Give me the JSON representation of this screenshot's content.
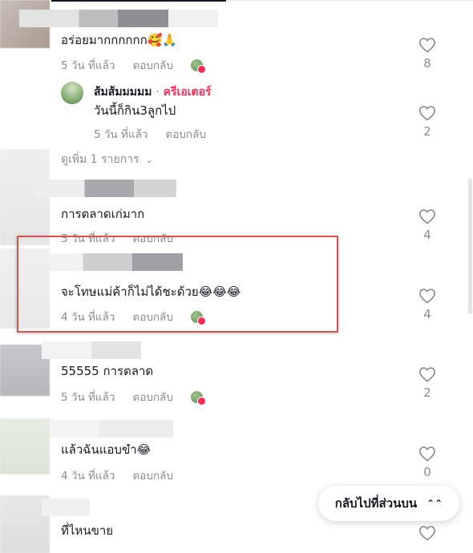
{
  "comments": [
    {
      "text": "อร่อยมากกกกกก🥰🙏",
      "time": "5 วัน ที่แล้ว",
      "reply": "ตอบกลับ",
      "likes": "8",
      "creator_liked": true
    },
    {
      "text": "การตลาดเก่มาก",
      "time": "3 วัน ที่แล้ว",
      "reply": "ตอบกลับ",
      "likes": "4",
      "creator_liked": false
    },
    {
      "text": "จะโทษแม่ค้าก็ไม่ได้ชะด้วย😂😂😂",
      "time": "4 วัน ที่แล้ว",
      "reply": "ตอบกลับ",
      "likes": "4",
      "creator_liked": true
    },
    {
      "text": "55555 การตลาด",
      "time": "5 วัน ที่แล้ว",
      "reply": "ตอบกลับ",
      "likes": "2",
      "creator_liked": true
    },
    {
      "text": "แล้วฉันแอบขำ😂",
      "time": "4 วัน ที่แล้ว",
      "reply": "ตอบกลับ",
      "likes": "0",
      "creator_liked": false
    },
    {
      "text": "ที่ไหนขาย",
      "time": "",
      "reply": "",
      "likes": "",
      "creator_liked": false
    }
  ],
  "creator_reply": {
    "name": "ส้มส้มมมมม",
    "separator": "·",
    "badge": "ครีเอเตอร์",
    "text": "วันนี้ก็กิน3ลูกไป",
    "time": "5 วัน ที่แล้ว",
    "reply": "ตอบกลับ",
    "likes": "2"
  },
  "see_more": {
    "label": "ดูเพิ่ม 1 รายการ",
    "icon": "chevron-down-icon"
  },
  "back_to_top": {
    "label": "กลับไปที่ส่วนบน",
    "icon": "double-chevron-up-icon"
  },
  "colors": {
    "accent": "#fe2c55",
    "muted": "#8a8b91",
    "text": "#161823",
    "highlight": "#d9534f"
  }
}
